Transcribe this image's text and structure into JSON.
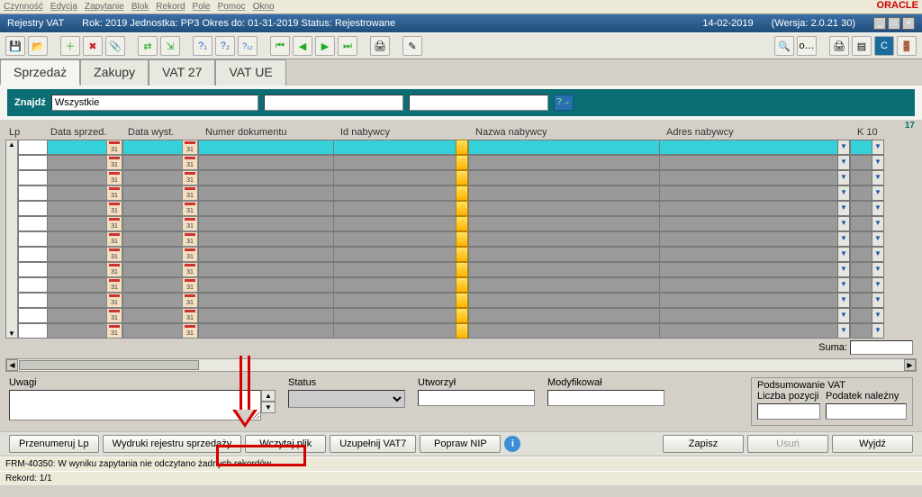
{
  "menu": [
    "Czynność",
    "Edycja",
    "Zapytanie",
    "Blok",
    "Rekord",
    "Pole",
    "Pomoc",
    "Okno"
  ],
  "brand": "ORACLE",
  "title": {
    "app": "Rejestry VAT",
    "info": "Rok: 2019 Jednostka: PP3 Okres do: 01-31-2019 Status: Rejestrowane",
    "date": "14-02-2019",
    "ver": "(Wersja: 2.0.21 30)"
  },
  "tabs": [
    "Sprzedaż",
    "Zakupy",
    "VAT 27",
    "VAT UE"
  ],
  "search": {
    "label": "Znajdź",
    "value": "Wszystkie",
    "count": "17"
  },
  "grid": {
    "headers": [
      "Lp",
      "Data sprzed.",
      "Data wyst.",
      "Numer dokumentu",
      "Id nabywcy",
      "Nazwa nabywcy",
      "Adres nabywcy",
      "K 10"
    ],
    "suma": "Suma:"
  },
  "bottom": {
    "uwagi": "Uwagi",
    "status": "Status",
    "utworzyl": "Utworzył",
    "modyfikowal": "Modyfikował",
    "summary_title": "Podsumowanie VAT",
    "liczba": "Liczba pozycji",
    "podatek": "Podatek należny"
  },
  "buttons": {
    "przenumeruj": "Przenumeruj Lp",
    "wydruki": "Wydruki rejestru sprzedaży",
    "wczytaj": "Wczytaj plik",
    "uzupelnij": "Uzupełnij VAT7",
    "popraw": "Popraw NIP",
    "zapisz": "Zapisz",
    "usun": "Usuń",
    "wyjdz": "Wyjdź"
  },
  "status_line": "FRM-40350: W wyniku zapytania nie odczytano żadnych rekordów",
  "record_line": "Rekord: 1/1"
}
